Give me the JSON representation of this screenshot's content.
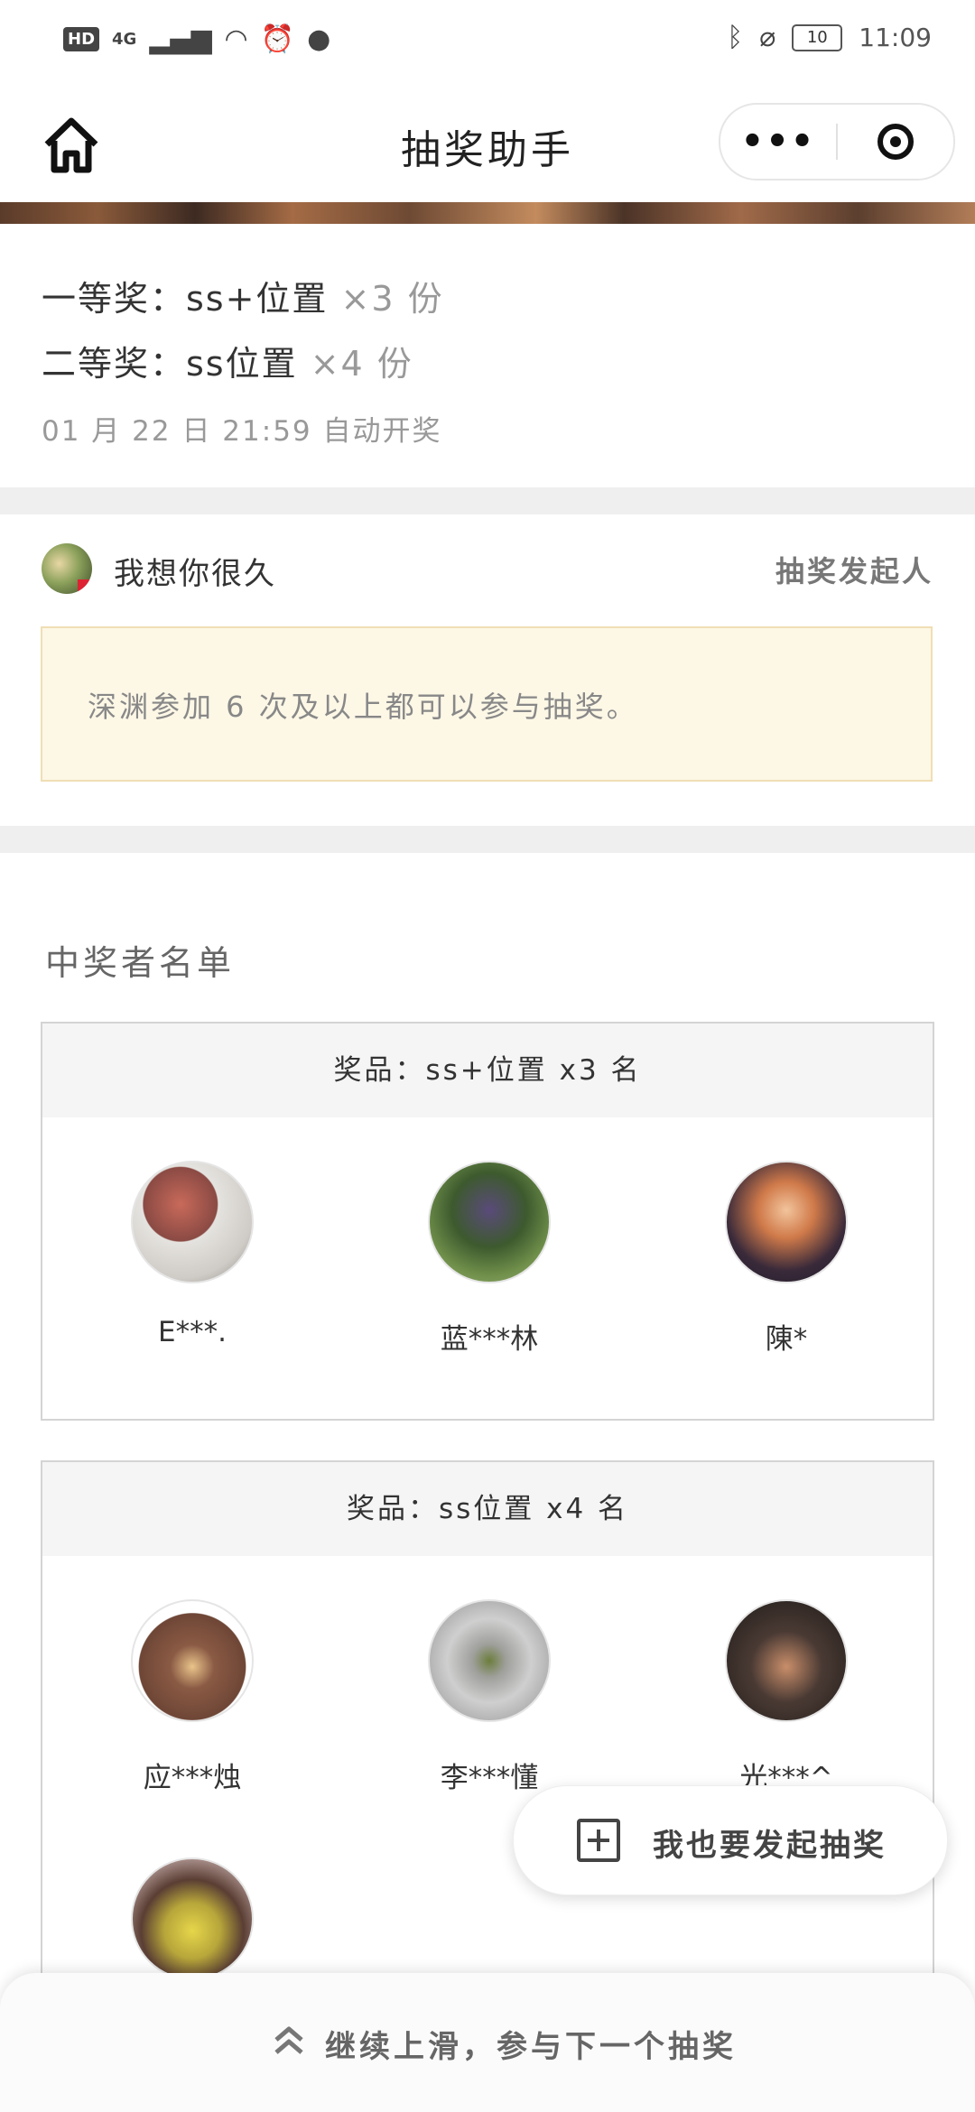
{
  "status_bar": {
    "left_badge": "HD",
    "network": "4G",
    "time": "11:09",
    "battery": "10"
  },
  "nav": {
    "title": "抽奖助手",
    "more_label": "•••"
  },
  "prizes": [
    {
      "label": "一等奖：ss+位置",
      "qty": "×3 份"
    },
    {
      "label": "二等奖：ss位置",
      "qty": "×4 份"
    }
  ],
  "draw_time": "01 月 22 日 21:59 自动开奖",
  "organizer": {
    "name": "我想你很久",
    "role": "抽奖发起人",
    "condition": "深渊参加 6 次及以上都可以参与抽奖。"
  },
  "winners_title": "中奖者名单",
  "prize_groups": [
    {
      "header": "奖品：ss+位置 x3 名",
      "winners": [
        {
          "name": "E***."
        },
        {
          "name": "蓝***林"
        },
        {
          "name": "陳*"
        }
      ]
    },
    {
      "header": "奖品：ss位置 x4 名",
      "winners": [
        {
          "name": "应***烛"
        },
        {
          "name": "李***懂"
        },
        {
          "name": "光***^"
        },
        {
          "name": ""
        }
      ]
    }
  ],
  "fab_label": "我也要发起抽奖",
  "bottom_label": "继续上滑，参与下一个抽奖"
}
